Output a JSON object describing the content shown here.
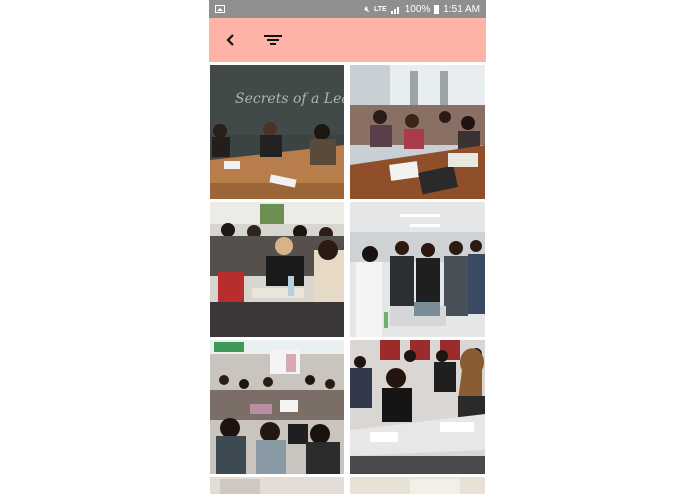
{
  "status_bar": {
    "battery": "100%",
    "time": "1:51 AM",
    "network": "LTE",
    "icons": [
      "image-icon",
      "mute-icon",
      "lte-icon",
      "signal-icon",
      "battery-icon"
    ]
  },
  "toolbar": {
    "background": "#ffb3a6",
    "back_icon": "chevron-left-icon",
    "filter_icon": "filter-icon"
  },
  "photos": [
    {
      "subject": "classroom-chalkboard-group",
      "chalkboard_text": "Secrets of a Lead Girls"
    },
    {
      "subject": "classroom-table-group"
    },
    {
      "subject": "crowded-room-group"
    },
    {
      "subject": "standing-group-laptops"
    },
    {
      "subject": "hackathon-crowd"
    },
    {
      "subject": "group-discussion-table"
    },
    {
      "subject": "partial-photo"
    },
    {
      "subject": "partial-photo"
    }
  ]
}
